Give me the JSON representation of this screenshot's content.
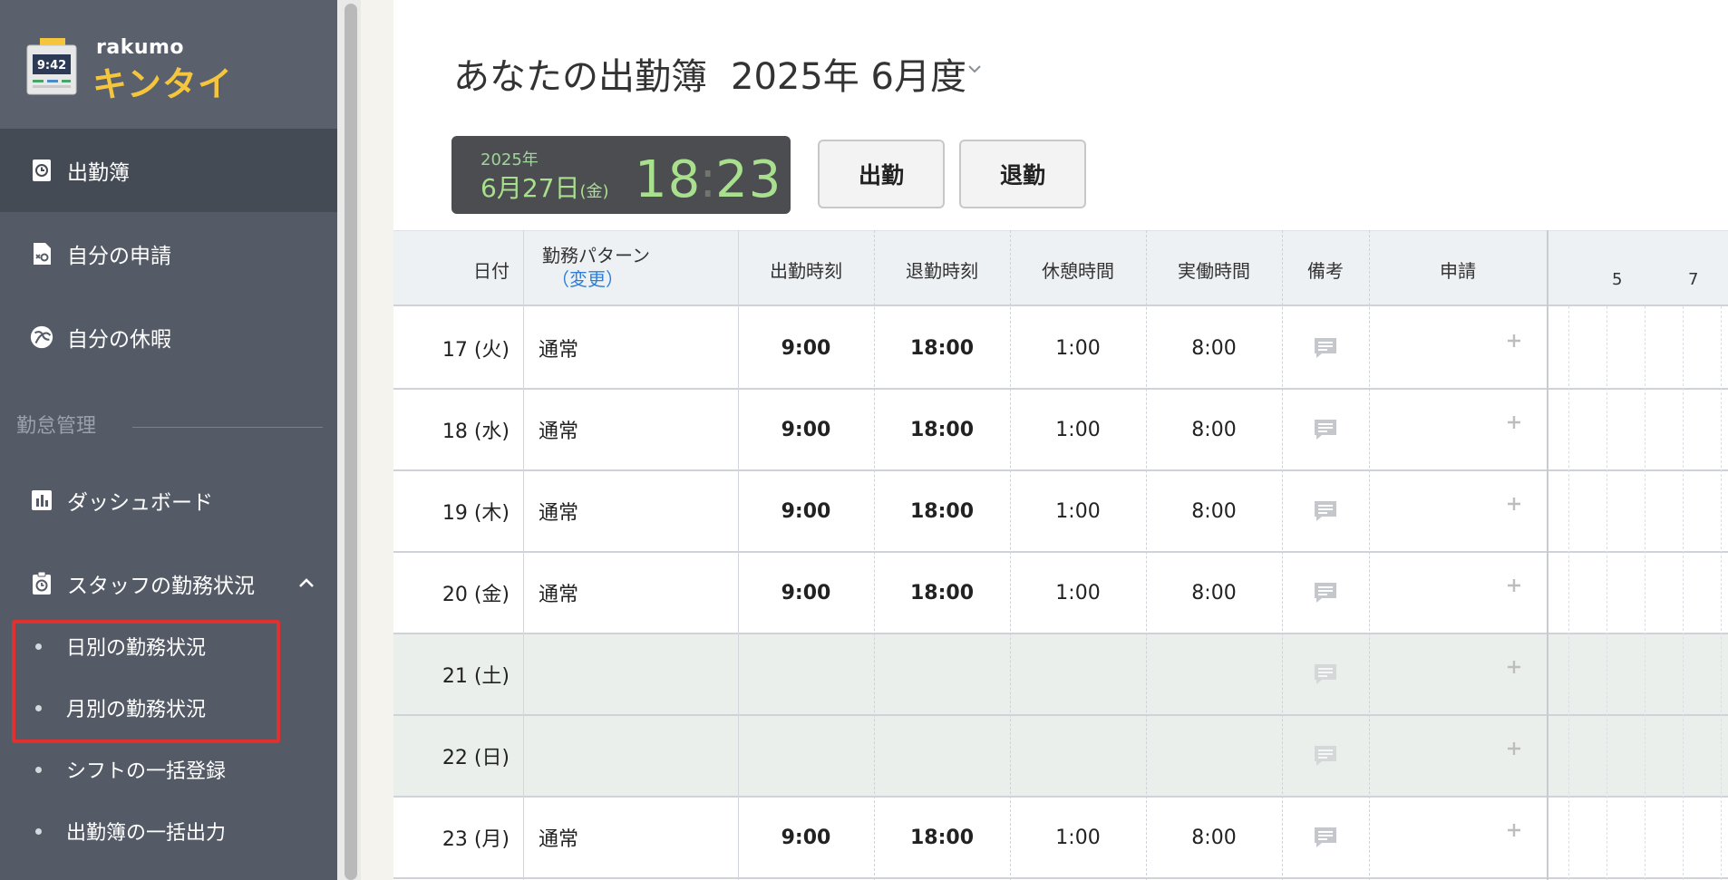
{
  "app": {
    "brand_small": "rakumo",
    "brand_big": "キンタイ",
    "logo_clock": "9:42"
  },
  "sidebar": {
    "items": [
      {
        "label": "出勤簿",
        "icon": "clock-book-icon",
        "active": true
      },
      {
        "label": "自分の申請",
        "icon": "request-doc-icon",
        "active": false
      },
      {
        "label": "自分の休暇",
        "icon": "palm-tree-icon",
        "active": false
      }
    ],
    "section_label": "勤怠管理",
    "manage_items": [
      {
        "label": "ダッシュボード",
        "icon": "bar-chart-icon"
      },
      {
        "label": "スタッフの勤務状況",
        "icon": "clipboard-clock-icon",
        "expanded": true
      }
    ],
    "sub_items": [
      {
        "label": "日別の勤務状況"
      },
      {
        "label": "月別の勤務状況"
      },
      {
        "label": "シフトの一括登録"
      },
      {
        "label": "出勤簿の一括出力"
      }
    ]
  },
  "header": {
    "title": "あなたの出勤簿",
    "period": "2025年 6月度"
  },
  "clock": {
    "year": "2025年",
    "date": "6月27日",
    "dow": "(金)",
    "hour": "18",
    "minute": "23"
  },
  "buttons": {
    "clock_in": "出勤",
    "clock_out": "退勤"
  },
  "table": {
    "headers": {
      "date": "日付",
      "pattern": "勤務パターン",
      "pattern_change": "（変更）",
      "start": "出勤時刻",
      "end": "退勤時刻",
      "break": "休憩時間",
      "actual": "実働時間",
      "note": "備考",
      "request": "申請"
    },
    "timeline_ticks": [
      "5",
      "7"
    ],
    "rows": [
      {
        "date": "17 (火)",
        "pattern": "通常",
        "start": "9:00",
        "end": "18:00",
        "break": "1:00",
        "actual": "8:00",
        "weekend": false
      },
      {
        "date": "18 (水)",
        "pattern": "通常",
        "start": "9:00",
        "end": "18:00",
        "break": "1:00",
        "actual": "8:00",
        "weekend": false
      },
      {
        "date": "19 (木)",
        "pattern": "通常",
        "start": "9:00",
        "end": "18:00",
        "break": "1:00",
        "actual": "8:00",
        "weekend": false
      },
      {
        "date": "20 (金)",
        "pattern": "通常",
        "start": "9:00",
        "end": "18:00",
        "break": "1:00",
        "actual": "8:00",
        "weekend": false
      },
      {
        "date": "21 (土)",
        "pattern": "",
        "start": "",
        "end": "",
        "break": "",
        "actual": "",
        "weekend": true
      },
      {
        "date": "22 (日)",
        "pattern": "",
        "start": "",
        "end": "",
        "break": "",
        "actual": "",
        "weekend": true
      },
      {
        "date": "23 (月)",
        "pattern": "通常",
        "start": "9:00",
        "end": "18:00",
        "break": "1:00",
        "actual": "8:00",
        "weekend": false
      }
    ]
  },
  "colors": {
    "sidebar_bg": "#545b67",
    "sidebar_active": "#454b55",
    "brand_yellow": "#f4c53d",
    "clock_green": "#a8e08e",
    "link_blue": "#2f7fd8",
    "highlight_red": "#e03131",
    "weekend_bg": "#ebefeb"
  }
}
